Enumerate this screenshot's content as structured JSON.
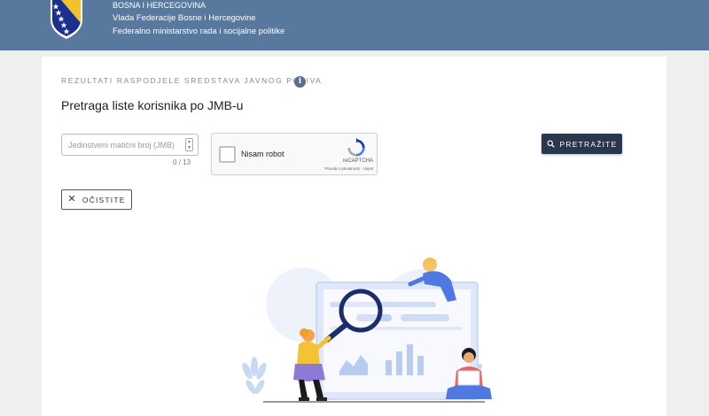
{
  "header": {
    "line1": "BOSNA I HERCEGOVINA",
    "line2": "Vlada Federacije Bosne i Hercegovine",
    "line3": "Federalno ministarstvo rada i socijalne politike"
  },
  "section": {
    "label": "REZULTATI RASPODJELE SREDSTAVA JAVNOG POZIVA",
    "info_icon": "i"
  },
  "page_title": "Pretraga liste korisnika po JMB-u",
  "jmb_field": {
    "placeholder": "Jedinstveni matični broj (JMB)",
    "value": "",
    "counter": "0 / 13"
  },
  "recaptcha": {
    "label": "Nisam robot",
    "brand": "reCAPTCHA",
    "terms": "Pravila o privatnosti - Uvjeti"
  },
  "buttons": {
    "search": "PRETRAŽITE",
    "clear": "OČISTITE",
    "clear_icon": "✕"
  },
  "colors": {
    "header_bg": "#58789e",
    "primary_button": "#28364e",
    "accent_blue": "#4f79e0"
  }
}
